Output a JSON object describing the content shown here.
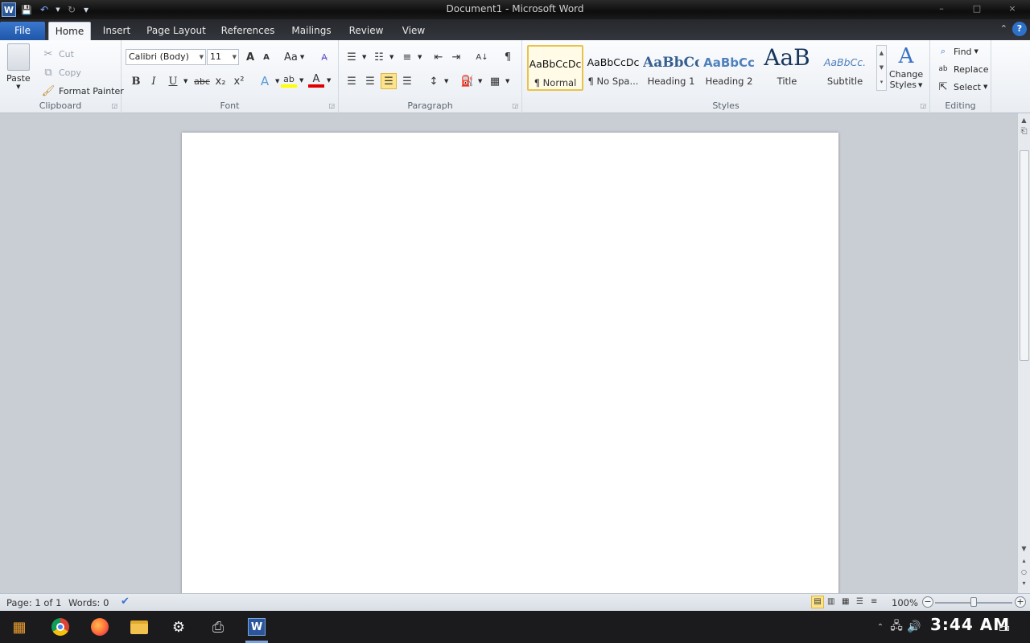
{
  "window": {
    "title": "Document1 - Microsoft Word",
    "minimize": "–",
    "maximize": "□",
    "close": "×"
  },
  "qat": {
    "logo": "W",
    "save": "💾",
    "undo": "↶",
    "redo": "↻",
    "customize": "▾"
  },
  "tabs": [
    {
      "label": "File"
    },
    {
      "label": "Home"
    },
    {
      "label": "Insert"
    },
    {
      "label": "Page Layout"
    },
    {
      "label": "References"
    },
    {
      "label": "Mailings"
    },
    {
      "label": "Review"
    },
    {
      "label": "View"
    }
  ],
  "help": "?",
  "clipboard": {
    "paste": "Paste",
    "cut": "Cut",
    "copy": "Copy",
    "format_painter": "Format Painter",
    "label": "Clipboard"
  },
  "font": {
    "family": "Calibri (Body)",
    "size": "11",
    "grow": "A",
    "shrink": "A",
    "case": "Aa",
    "bold": "B",
    "italic": "I",
    "underline": "U",
    "strike": "abc",
    "subscript": "x₂",
    "superscript": "x²",
    "effects": "A",
    "highlight": "ab",
    "color": "A",
    "label": "Font"
  },
  "paragraph": {
    "sort": "A↓",
    "pilcrow": "¶",
    "label": "Paragraph"
  },
  "styles": {
    "items": [
      {
        "sample": "AaBbCcDc",
        "name": "¶ Normal"
      },
      {
        "sample": "AaBbCcDc",
        "name": "¶ No Spa..."
      },
      {
        "sample": "AaBbCc",
        "name": "Heading 1"
      },
      {
        "sample": "AaBbCc",
        "name": "Heading 2"
      },
      {
        "sample": "AaB",
        "name": "Title"
      },
      {
        "sample": "AaBbCc.",
        "name": "Subtitle"
      }
    ],
    "change_styles_line1": "Change",
    "change_styles_line2": "Styles",
    "label": "Styles"
  },
  "editing": {
    "find": "Find",
    "replace": "Replace",
    "select": "Select",
    "label": "Editing"
  },
  "status": {
    "page": "Page: 1 of 1",
    "words": "Words: 0",
    "zoom": "100%",
    "zoom_out": "−",
    "zoom_in": "+"
  },
  "taskbar": {
    "clock": "3:44 AM"
  },
  "colors": {
    "accent": "#2b579a",
    "file_tab": "#2a64bb",
    "highlight": "#ffff00",
    "font_color": "#e00000",
    "selected_style": "#e9c24a"
  }
}
